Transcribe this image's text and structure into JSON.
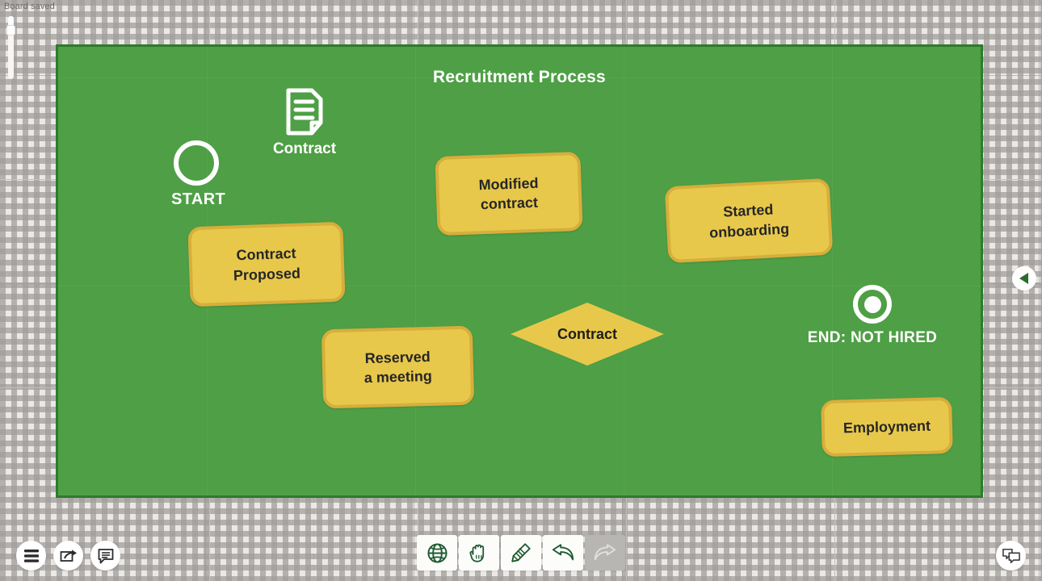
{
  "status": {
    "text": "Board saved"
  },
  "zoom_slider": {
    "name": "zoom-slider"
  },
  "board": {
    "title": "Recruitment Process",
    "border_color": "#2f7a2b",
    "fill_color": "#4e9f45"
  },
  "nodes": {
    "start": {
      "label": "START",
      "type": "start-event"
    },
    "document": {
      "label": "Contract",
      "type": "document"
    },
    "contract_proposed": {
      "label_line1": "Contract",
      "label_line2": "Proposed"
    },
    "modified_contract": {
      "label_line1": "Modified",
      "label_line2": "contract"
    },
    "started_onboarding": {
      "label_line1": "Started",
      "label_line2": "onboarding"
    },
    "reserved_meeting": {
      "label_line1": "Reserved",
      "label_line2": "a meeting"
    },
    "decision": {
      "label": "Contract",
      "type": "gateway"
    },
    "employment": {
      "label": "Employment"
    },
    "end": {
      "label": "END: NOT HIRED",
      "type": "end-event"
    }
  },
  "shape_colors": {
    "task_fill": "#e8c84b",
    "task_border": "#d8ae3b",
    "task_text": "#262626",
    "white": "#ffffff"
  },
  "toolbar_left": {
    "items": [
      {
        "icon": "menu-icon",
        "label": "Menu"
      },
      {
        "icon": "share-icon",
        "label": "Share"
      },
      {
        "icon": "notes-icon",
        "label": "Notes"
      }
    ]
  },
  "toolbar_center": {
    "items": [
      {
        "icon": "globe-icon",
        "label": "Globe",
        "state": "enabled"
      },
      {
        "icon": "hand-icon",
        "label": "Pan",
        "state": "enabled"
      },
      {
        "icon": "pencil-icon",
        "label": "Draw",
        "state": "enabled"
      },
      {
        "icon": "undo-icon",
        "label": "Undo",
        "state": "enabled"
      },
      {
        "icon": "redo-icon",
        "label": "Redo",
        "state": "disabled"
      }
    ]
  },
  "toolbar_right": {
    "items": [
      {
        "icon": "chat-bubbles-icon",
        "label": "Chat"
      }
    ]
  },
  "side_tab": {
    "icon": "triangle-left-icon",
    "label": "Collapse panel"
  }
}
